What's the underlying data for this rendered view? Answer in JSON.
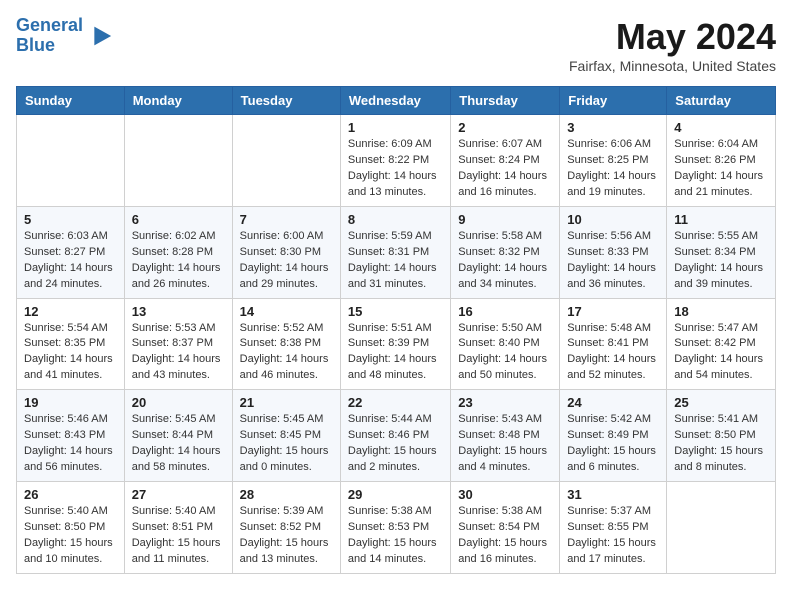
{
  "header": {
    "logo_line1": "General",
    "logo_line2": "Blue",
    "month_title": "May 2024",
    "location": "Fairfax, Minnesota, United States"
  },
  "weekdays": [
    "Sunday",
    "Monday",
    "Tuesday",
    "Wednesday",
    "Thursday",
    "Friday",
    "Saturday"
  ],
  "weeks": [
    [
      {
        "day": "",
        "info": ""
      },
      {
        "day": "",
        "info": ""
      },
      {
        "day": "",
        "info": ""
      },
      {
        "day": "1",
        "info": "Sunrise: 6:09 AM\nSunset: 8:22 PM\nDaylight: 14 hours\nand 13 minutes."
      },
      {
        "day": "2",
        "info": "Sunrise: 6:07 AM\nSunset: 8:24 PM\nDaylight: 14 hours\nand 16 minutes."
      },
      {
        "day": "3",
        "info": "Sunrise: 6:06 AM\nSunset: 8:25 PM\nDaylight: 14 hours\nand 19 minutes."
      },
      {
        "day": "4",
        "info": "Sunrise: 6:04 AM\nSunset: 8:26 PM\nDaylight: 14 hours\nand 21 minutes."
      }
    ],
    [
      {
        "day": "5",
        "info": "Sunrise: 6:03 AM\nSunset: 8:27 PM\nDaylight: 14 hours\nand 24 minutes."
      },
      {
        "day": "6",
        "info": "Sunrise: 6:02 AM\nSunset: 8:28 PM\nDaylight: 14 hours\nand 26 minutes."
      },
      {
        "day": "7",
        "info": "Sunrise: 6:00 AM\nSunset: 8:30 PM\nDaylight: 14 hours\nand 29 minutes."
      },
      {
        "day": "8",
        "info": "Sunrise: 5:59 AM\nSunset: 8:31 PM\nDaylight: 14 hours\nand 31 minutes."
      },
      {
        "day": "9",
        "info": "Sunrise: 5:58 AM\nSunset: 8:32 PM\nDaylight: 14 hours\nand 34 minutes."
      },
      {
        "day": "10",
        "info": "Sunrise: 5:56 AM\nSunset: 8:33 PM\nDaylight: 14 hours\nand 36 minutes."
      },
      {
        "day": "11",
        "info": "Sunrise: 5:55 AM\nSunset: 8:34 PM\nDaylight: 14 hours\nand 39 minutes."
      }
    ],
    [
      {
        "day": "12",
        "info": "Sunrise: 5:54 AM\nSunset: 8:35 PM\nDaylight: 14 hours\nand 41 minutes."
      },
      {
        "day": "13",
        "info": "Sunrise: 5:53 AM\nSunset: 8:37 PM\nDaylight: 14 hours\nand 43 minutes."
      },
      {
        "day": "14",
        "info": "Sunrise: 5:52 AM\nSunset: 8:38 PM\nDaylight: 14 hours\nand 46 minutes."
      },
      {
        "day": "15",
        "info": "Sunrise: 5:51 AM\nSunset: 8:39 PM\nDaylight: 14 hours\nand 48 minutes."
      },
      {
        "day": "16",
        "info": "Sunrise: 5:50 AM\nSunset: 8:40 PM\nDaylight: 14 hours\nand 50 minutes."
      },
      {
        "day": "17",
        "info": "Sunrise: 5:48 AM\nSunset: 8:41 PM\nDaylight: 14 hours\nand 52 minutes."
      },
      {
        "day": "18",
        "info": "Sunrise: 5:47 AM\nSunset: 8:42 PM\nDaylight: 14 hours\nand 54 minutes."
      }
    ],
    [
      {
        "day": "19",
        "info": "Sunrise: 5:46 AM\nSunset: 8:43 PM\nDaylight: 14 hours\nand 56 minutes."
      },
      {
        "day": "20",
        "info": "Sunrise: 5:45 AM\nSunset: 8:44 PM\nDaylight: 14 hours\nand 58 minutes."
      },
      {
        "day": "21",
        "info": "Sunrise: 5:45 AM\nSunset: 8:45 PM\nDaylight: 15 hours\nand 0 minutes."
      },
      {
        "day": "22",
        "info": "Sunrise: 5:44 AM\nSunset: 8:46 PM\nDaylight: 15 hours\nand 2 minutes."
      },
      {
        "day": "23",
        "info": "Sunrise: 5:43 AM\nSunset: 8:48 PM\nDaylight: 15 hours\nand 4 minutes."
      },
      {
        "day": "24",
        "info": "Sunrise: 5:42 AM\nSunset: 8:49 PM\nDaylight: 15 hours\nand 6 minutes."
      },
      {
        "day": "25",
        "info": "Sunrise: 5:41 AM\nSunset: 8:50 PM\nDaylight: 15 hours\nand 8 minutes."
      }
    ],
    [
      {
        "day": "26",
        "info": "Sunrise: 5:40 AM\nSunset: 8:50 PM\nDaylight: 15 hours\nand 10 minutes."
      },
      {
        "day": "27",
        "info": "Sunrise: 5:40 AM\nSunset: 8:51 PM\nDaylight: 15 hours\nand 11 minutes."
      },
      {
        "day": "28",
        "info": "Sunrise: 5:39 AM\nSunset: 8:52 PM\nDaylight: 15 hours\nand 13 minutes."
      },
      {
        "day": "29",
        "info": "Sunrise: 5:38 AM\nSunset: 8:53 PM\nDaylight: 15 hours\nand 14 minutes."
      },
      {
        "day": "30",
        "info": "Sunrise: 5:38 AM\nSunset: 8:54 PM\nDaylight: 15 hours\nand 16 minutes."
      },
      {
        "day": "31",
        "info": "Sunrise: 5:37 AM\nSunset: 8:55 PM\nDaylight: 15 hours\nand 17 minutes."
      },
      {
        "day": "",
        "info": ""
      }
    ]
  ]
}
